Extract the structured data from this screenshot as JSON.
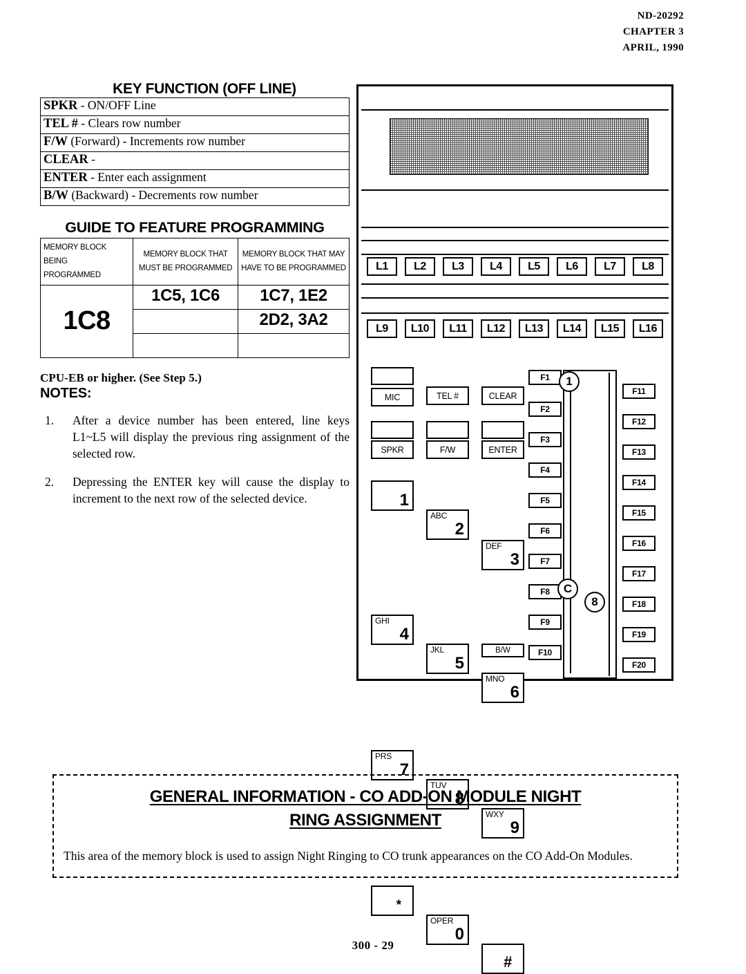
{
  "header": {
    "doc_number": "ND-20292",
    "chapter": "CHAPTER 3",
    "date": "APRIL, 1990"
  },
  "key_function": {
    "title": "KEY FUNCTION (OFF LINE)",
    "rows": [
      {
        "key": "SPKR",
        "desc": "-  ON/OFF Line"
      },
      {
        "key": "TEL #",
        "desc": "-  Clears row number"
      },
      {
        "key": "F/W",
        "desc": "(Forward) - Increments row number"
      },
      {
        "key": "CLEAR",
        "desc": "-"
      },
      {
        "key": "ENTER",
        "desc": "- Enter each assignment"
      },
      {
        "key": "B/W",
        "desc": "(Backward) - Decrements row number"
      }
    ]
  },
  "guide": {
    "title": "GUIDE TO FEATURE PROGRAMMING",
    "headers": [
      "MEMORY BLOCK BEING PROGRAMMED",
      "MEMORY BLOCK THAT MUST BE PROGRAMMED",
      "MEMORY BLOCK THAT MAY HAVE TO BE PROGRAMMED"
    ],
    "header_lines": [
      [
        "MEMORY BLOCK BEING",
        "PROGRAMMED"
      ],
      [
        "MEMORY BLOCK THAT",
        "MUST BE PROGRAMMED"
      ],
      [
        "MEMORY BLOCK THAT MAY",
        "HAVE TO BE PROGRAMMED"
      ]
    ],
    "block_being_programmed": "1C8",
    "must_be_programmed": [
      "1C5, 1C6",
      "",
      ""
    ],
    "may_have_to_be_programmed": [
      "1C7, 1E2",
      "2D2, 3A2",
      ""
    ]
  },
  "notes": {
    "cpu_line": "CPU-EB or higher.  (See Step 5.)",
    "title": "NOTES:",
    "items": [
      {
        "num": "1.",
        "text": "After a device number has been entered, line keys L1~L5 will display the previous ring assignment of the selected row."
      },
      {
        "num": "2.",
        "text": "Depressing the ENTER key will cause the display to increment to the next row of the selected device."
      }
    ]
  },
  "phone": {
    "line_keys_row1": [
      "L1",
      "L2",
      "L3",
      "L4",
      "L5",
      "L6",
      "L7",
      "L8"
    ],
    "line_keys_row2": [
      "L9",
      "L10",
      "L11",
      "L12",
      "L13",
      "L14",
      "L15",
      "L16"
    ],
    "function_keys": [
      {
        "label": "MIC",
        "has_blank_above": true
      },
      {
        "label": "TEL #",
        "has_blank_above": false
      },
      {
        "label": "CLEAR",
        "has_blank_above": false
      },
      {
        "label": "SPKR",
        "has_blank_above": true
      },
      {
        "label": "F/W",
        "has_blank_above": true
      },
      {
        "label": "ENTER",
        "has_blank_above": true
      }
    ],
    "keypad": [
      {
        "letters": "",
        "digit": "1"
      },
      {
        "letters": "ABC",
        "digit": "2"
      },
      {
        "letters": "DEF",
        "digit": "3"
      },
      {
        "letters": "GHI",
        "digit": "4"
      },
      {
        "letters": "JKL",
        "digit": "5"
      },
      {
        "letters": "MNO",
        "digit": "6"
      },
      {
        "letters": "PRS",
        "digit": "7"
      },
      {
        "letters": "TUV",
        "digit": "8"
      },
      {
        "letters": "WXY",
        "digit": "9"
      },
      {
        "letters": "",
        "digit": "*"
      },
      {
        "letters": "OPER",
        "digit": "0"
      },
      {
        "letters": "",
        "digit": "#"
      }
    ],
    "bw_key": "B/W",
    "f_keys_left": [
      "F1",
      "F2",
      "F3",
      "F4",
      "F5",
      "F6",
      "F7",
      "F8",
      "F9",
      "F10"
    ],
    "f_keys_right": [
      "F11",
      "F12",
      "F13",
      "F14",
      "F15",
      "F16",
      "F17",
      "F18",
      "F19",
      "F20"
    ],
    "markers": [
      "1",
      "C",
      "8"
    ]
  },
  "general_info": {
    "heading_line1": "GENERAL  INFORMATION  -  CO ADD-ON MODULE NIGHT",
    "heading_line2": "RING ASSIGNMENT",
    "body": "This area of the memory block is used to assign Night Ringing to CO trunk appearances on the CO Add-On Modules."
  },
  "footer": {
    "page_number": "300 - 29"
  }
}
